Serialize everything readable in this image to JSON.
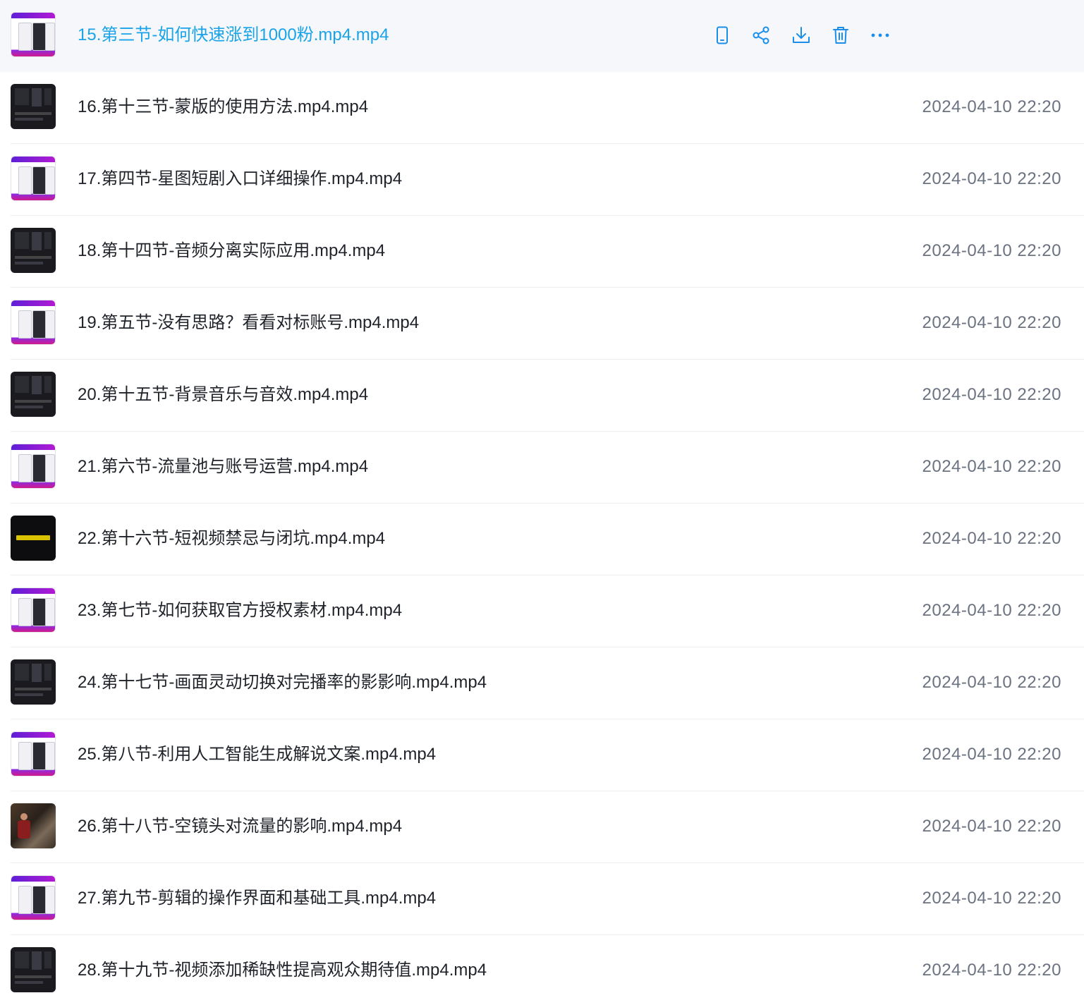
{
  "active_index": 0,
  "actions": [
    {
      "name": "mobile-icon"
    },
    {
      "name": "share-icon"
    },
    {
      "name": "download-icon"
    },
    {
      "name": "trash-icon"
    },
    {
      "name": "more-icon"
    }
  ],
  "colors": {
    "accent": "#1aa3e8",
    "icon": "#1a8ee8",
    "text": "#1f2329",
    "muted": "#6b7280",
    "active_bg": "#f5f7fa"
  },
  "files": [
    {
      "name": "15.第三节-如何快速涨到1000粉.mp4.mp4",
      "time": "",
      "thumb": "purple"
    },
    {
      "name": "16.第十三节-蒙版的使用方法.mp4.mp4",
      "time": "2024-04-10 22:20",
      "thumb": "dark"
    },
    {
      "name": "17.第四节-星图短剧入口详细操作.mp4.mp4",
      "time": "2024-04-10 22:20",
      "thumb": "purple"
    },
    {
      "name": "18.第十四节-音频分离实际应用.mp4.mp4",
      "time": "2024-04-10 22:20",
      "thumb": "dark"
    },
    {
      "name": "19.第五节-没有思路？看看对标账号.mp4.mp4",
      "time": "2024-04-10 22:20",
      "thumb": "purple"
    },
    {
      "name": "20.第十五节-背景音乐与音效.mp4.mp4",
      "time": "2024-04-10 22:20",
      "thumb": "dark"
    },
    {
      "name": "21.第六节-流量池与账号运营.mp4.mp4",
      "time": "2024-04-10 22:20",
      "thumb": "purple"
    },
    {
      "name": "22.第十六节-短视频禁忌与闭坑.mp4.mp4",
      "time": "2024-04-10 22:20",
      "thumb": "black"
    },
    {
      "name": "23.第七节-如何获取官方授权素材.mp4.mp4",
      "time": "2024-04-10 22:20",
      "thumb": "purple"
    },
    {
      "name": "24.第十七节-画面灵动切换对完播率的影影响.mp4.mp4",
      "time": "2024-04-10 22:20",
      "thumb": "dark"
    },
    {
      "name": "25.第八节-利用人工智能生成解说文案.mp4.mp4",
      "time": "2024-04-10 22:20",
      "thumb": "purple"
    },
    {
      "name": "26.第十八节-空镜头对流量的影响.mp4.mp4",
      "time": "2024-04-10 22:20",
      "thumb": "photo"
    },
    {
      "name": "27.第九节-剪辑的操作界面和基础工具.mp4.mp4",
      "time": "2024-04-10 22:20",
      "thumb": "purple"
    },
    {
      "name": "28.第十九节-视频添加稀缺性提高观众期待值.mp4.mp4",
      "time": "2024-04-10 22:20",
      "thumb": "dark"
    }
  ]
}
